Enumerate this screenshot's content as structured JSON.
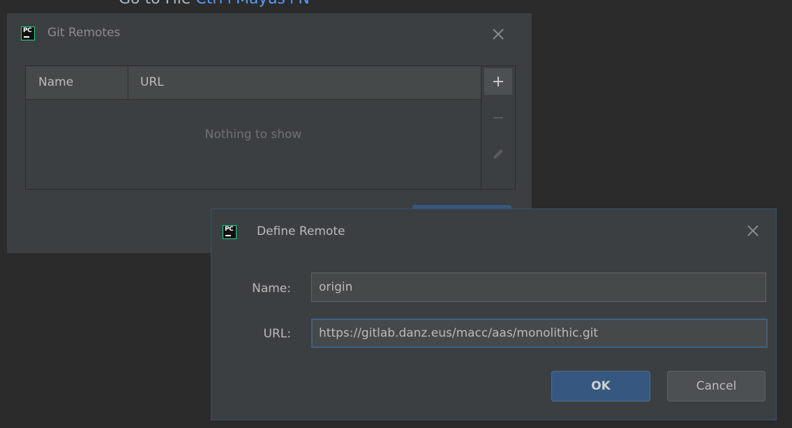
{
  "background": {
    "hint_label": "Go to File",
    "hint_shortcut": "Ctrl+Mayus+N"
  },
  "git_remotes_dialog": {
    "app_logo": "PC",
    "title": "Git Remotes",
    "close_icon": "close-icon",
    "table": {
      "columns": [
        "Name",
        "URL"
      ],
      "empty_text": "Nothing to show"
    },
    "toolbar": {
      "add_icon": "plus-icon",
      "remove_icon": "minus-icon",
      "edit_icon": "pencil-icon"
    }
  },
  "define_remote_dialog": {
    "app_logo": "PC",
    "title": "Define Remote",
    "close_icon": "close-icon",
    "name_label": "Name:",
    "name_value": "origin",
    "url_label": "URL:",
    "url_value": "https://gitlab.danz.eus/macc/aas/monolithic.git",
    "ok_label": "OK",
    "cancel_label": "Cancel"
  },
  "colors": {
    "dialog_bg": "#3c3f41",
    "primary_button": "#365880",
    "focus_border": "#3d6185",
    "logo_accent": "#21d789"
  }
}
